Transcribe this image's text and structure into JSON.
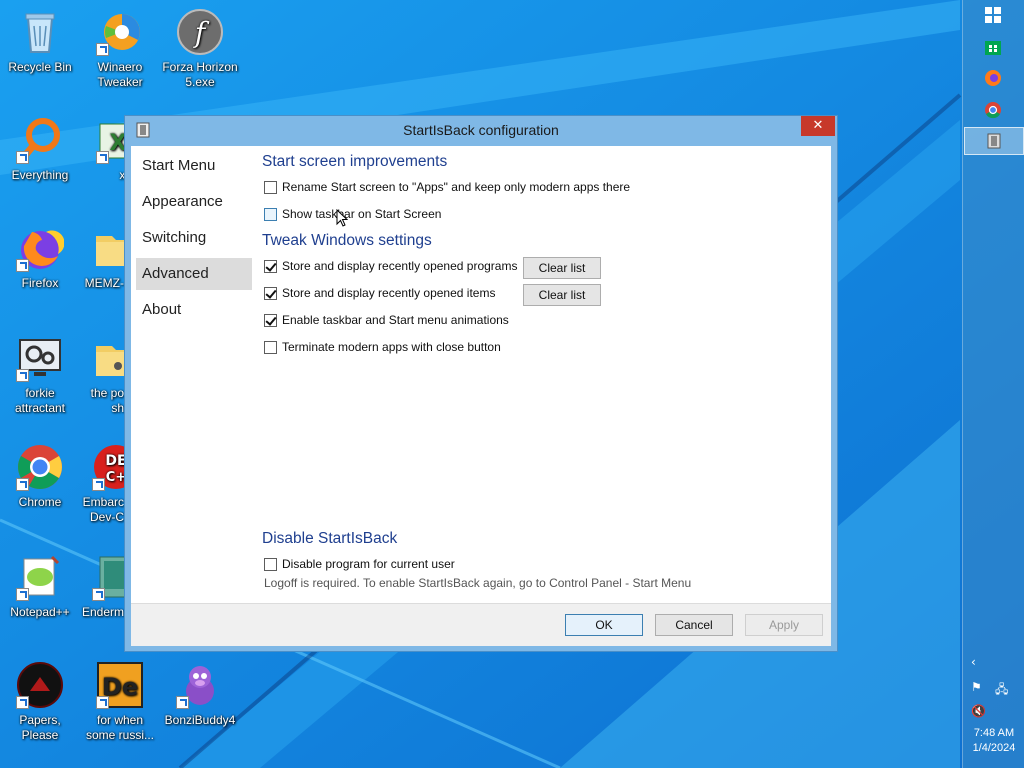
{
  "desktop": {
    "icons": [
      {
        "label": "Recycle Bin"
      },
      {
        "label": "Winaero\nTweaker"
      },
      {
        "label": "Forza Horizon\n5.exe"
      },
      {
        "label": "Everything"
      },
      {
        "label": "xL"
      },
      {
        "label": "Firefox"
      },
      {
        "label": "MEMZ-"
      },
      {
        "label": "forkie\nattractant"
      },
      {
        "label": "the po\nsh"
      },
      {
        "label": "Chrome"
      },
      {
        "label": "Embarc\nDev-C"
      },
      {
        "label": "Notepad++"
      },
      {
        "label": "Enderm"
      },
      {
        "label": "Papers, Please"
      },
      {
        "label": "for when\nsome russi..."
      },
      {
        "label": "BonziBuddy4"
      }
    ]
  },
  "taskbar": {
    "clock_time": "7:48 AM",
    "clock_date": "1/4/2024"
  },
  "window": {
    "title": "StartIsBack configuration",
    "close_label": "✕",
    "nav": [
      "Start Menu",
      "Appearance",
      "Switching",
      "Advanced",
      "About"
    ],
    "selected_nav": "Advanced",
    "sections": {
      "start_screen": {
        "heading": "Start screen improvements",
        "options": [
          {
            "label": "Rename Start screen to \"Apps\" and keep only modern apps there",
            "checked": false
          },
          {
            "label": "Show taskbar on Start Screen",
            "checked": false
          }
        ]
      },
      "tweak": {
        "heading": "Tweak Windows settings",
        "options": [
          {
            "label": "Store and display recently opened programs",
            "checked": true
          },
          {
            "label": "Store and display recently opened items",
            "checked": true
          },
          {
            "label": "Enable taskbar and Start menu animations",
            "checked": true
          },
          {
            "label": "Terminate modern apps with close button",
            "checked": false
          }
        ],
        "clear_list_label": "Clear list"
      },
      "disable": {
        "heading": "Disable StartIsBack",
        "option": {
          "label": "Disable program for current user",
          "checked": false
        },
        "note": "Logoff is required. To enable StartIsBack again, go to Control Panel - Start Menu"
      }
    },
    "buttons": {
      "ok": "OK",
      "cancel": "Cancel",
      "apply": "Apply"
    }
  }
}
